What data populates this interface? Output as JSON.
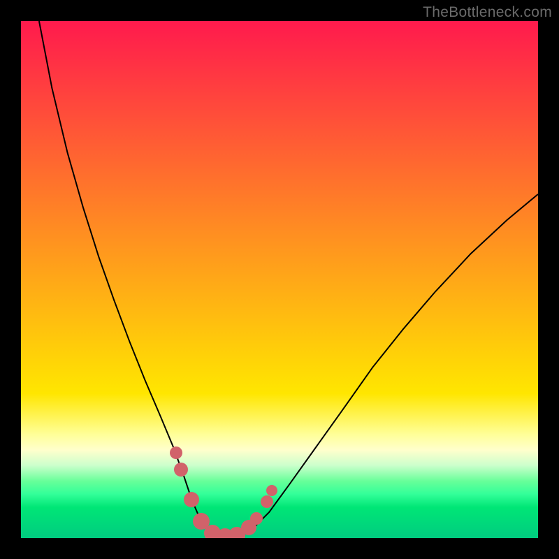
{
  "watermark": "TheBottleneck.com",
  "chart_data": {
    "type": "line",
    "title": "",
    "xlabel": "",
    "ylabel": "",
    "xlim_norm": [
      0,
      1
    ],
    "ylim_norm": [
      0,
      1
    ],
    "gradient_strips": [
      {
        "height_frac": 0.72,
        "from": "#ff1a4d",
        "to": "#ffe600"
      },
      {
        "height_frac": 0.08,
        "from": "#ffe600",
        "to": "#ffff99"
      },
      {
        "height_frac": 0.03,
        "from": "#ffff99",
        "to": "#ffffcc"
      },
      {
        "height_frac": 0.03,
        "from": "#ffffcc",
        "to": "#ccffcc"
      },
      {
        "height_frac": 0.03,
        "from": "#ccffcc",
        "to": "#66ff99"
      },
      {
        "height_frac": 0.025,
        "from": "#66ff99",
        "to": "#33ff99"
      },
      {
        "height_frac": 0.025,
        "from": "#33ff99",
        "to": "#00e676"
      },
      {
        "height_frac": 0.06,
        "from": "#00e676",
        "to": "#00cc80"
      }
    ],
    "curve_points": [
      {
        "x": 0.035,
        "y": 1.0
      },
      {
        "x": 0.06,
        "y": 0.87
      },
      {
        "x": 0.09,
        "y": 0.745
      },
      {
        "x": 0.12,
        "y": 0.64
      },
      {
        "x": 0.15,
        "y": 0.545
      },
      {
        "x": 0.18,
        "y": 0.46
      },
      {
        "x": 0.21,
        "y": 0.38
      },
      {
        "x": 0.24,
        "y": 0.305
      },
      {
        "x": 0.27,
        "y": 0.235
      },
      {
        "x": 0.295,
        "y": 0.175
      },
      {
        "x": 0.315,
        "y": 0.12
      },
      {
        "x": 0.33,
        "y": 0.075
      },
      {
        "x": 0.345,
        "y": 0.04
      },
      {
        "x": 0.36,
        "y": 0.018
      },
      {
        "x": 0.38,
        "y": 0.006
      },
      {
        "x": 0.4,
        "y": 0.0
      },
      {
        "x": 0.425,
        "y": 0.004
      },
      {
        "x": 0.45,
        "y": 0.02
      },
      {
        "x": 0.48,
        "y": 0.05
      },
      {
        "x": 0.52,
        "y": 0.105
      },
      {
        "x": 0.57,
        "y": 0.175
      },
      {
        "x": 0.62,
        "y": 0.245
      },
      {
        "x": 0.68,
        "y": 0.33
      },
      {
        "x": 0.74,
        "y": 0.405
      },
      {
        "x": 0.8,
        "y": 0.475
      },
      {
        "x": 0.87,
        "y": 0.55
      },
      {
        "x": 0.94,
        "y": 0.615
      },
      {
        "x": 1.0,
        "y": 0.665
      }
    ],
    "markers": [
      {
        "x": 0.3,
        "y": 0.165,
        "r": 9,
        "color": "#d1626a"
      },
      {
        "x": 0.31,
        "y": 0.133,
        "r": 10,
        "color": "#d1626a"
      },
      {
        "x": 0.33,
        "y": 0.075,
        "r": 11,
        "color": "#d1626a"
      },
      {
        "x": 0.348,
        "y": 0.032,
        "r": 12,
        "color": "#d1626a"
      },
      {
        "x": 0.37,
        "y": 0.01,
        "r": 12,
        "color": "#d1626a"
      },
      {
        "x": 0.395,
        "y": 0.003,
        "r": 12,
        "color": "#d1626a"
      },
      {
        "x": 0.418,
        "y": 0.005,
        "r": 12,
        "color": "#d1626a"
      },
      {
        "x": 0.44,
        "y": 0.02,
        "r": 11,
        "color": "#d1626a"
      },
      {
        "x": 0.455,
        "y": 0.038,
        "r": 9,
        "color": "#d1626a"
      },
      {
        "x": 0.475,
        "y": 0.07,
        "r": 9,
        "color": "#d1626a"
      },
      {
        "x": 0.485,
        "y": 0.092,
        "r": 8,
        "color": "#d1626a"
      }
    ],
    "notes": "Axes are not labeled in the source image; x and y are normalized 0–1. y=1 corresponds to the top of the colored plot area; y=0 corresponds to the bottom green band."
  }
}
